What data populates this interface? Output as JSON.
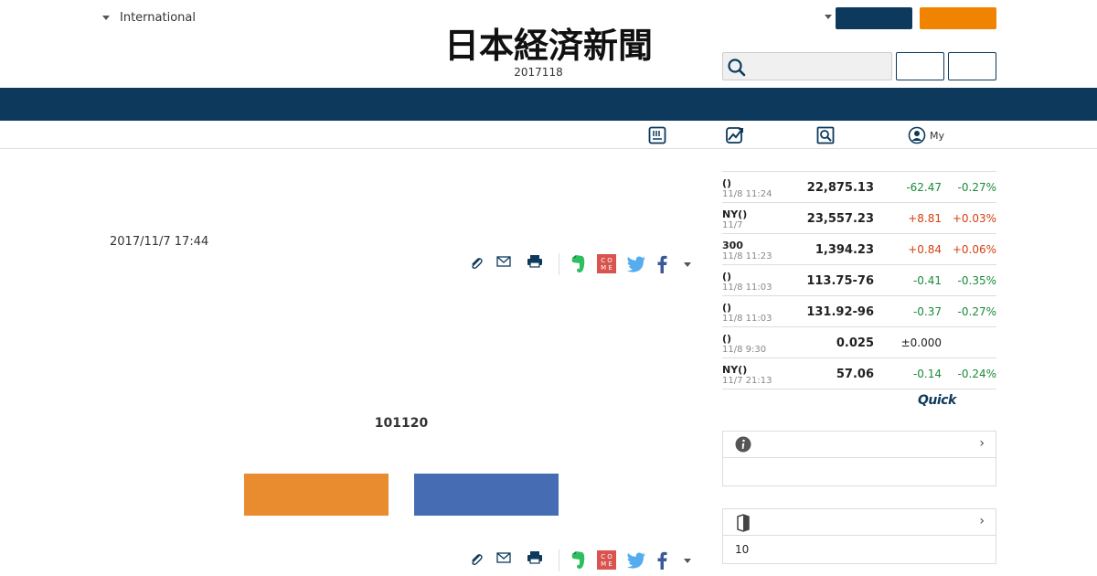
{
  "header": {
    "edition_label": "International",
    "logo_text": "日本経済新聞",
    "date": "2017118",
    "colors": {
      "navy": "#0d3a5c",
      "orange": "#f08300"
    }
  },
  "subnav": {
    "items": [
      {
        "icon": "newspaper-icon",
        "label": ""
      },
      {
        "icon": "chart-icon",
        "label": ""
      },
      {
        "icon": "search-icon",
        "label": ""
      },
      {
        "icon": "user-icon",
        "label": "My"
      }
    ]
  },
  "article": {
    "published": "2017/11/7 17:44",
    "heading": "101120",
    "share_icons": [
      "paperclip-icon",
      "mail-icon",
      "print-icon",
      "evernote-icon",
      "comment-icon",
      "twitter-icon",
      "facebook-icon",
      "more-caret-icon"
    ]
  },
  "market": {
    "rows": [
      {
        "name": "()",
        "time": "11/8 11:24",
        "value": "22,875.13",
        "change": "-62.47",
        "pct": "-0.27%",
        "dir": "down"
      },
      {
        "name": "NY()",
        "time": "11/7",
        "value": "23,557.23",
        "change": "+8.81",
        "pct": "+0.03%",
        "dir": "up"
      },
      {
        "name": "300",
        "time": "11/8 11:23",
        "value": "1,394.23",
        "change": "+0.84",
        "pct": "+0.06%",
        "dir": "up"
      },
      {
        "name": "()",
        "time": "11/8 11:03",
        "value": "113.75-76",
        "change": "-0.41",
        "pct": "-0.35%",
        "dir": "down"
      },
      {
        "name": "()",
        "time": "11/8 11:03",
        "value": "131.92-96",
        "change": "-0.37",
        "pct": "-0.27%",
        "dir": "down"
      },
      {
        "name": "()",
        "time": "11/8 9:30",
        "value": "0.025",
        "change": "±0.000",
        "pct": "",
        "dir": "flat"
      },
      {
        "name": "NY()",
        "time": "11/7 21:13",
        "value": "57.06",
        "change": "-0.14",
        "pct": "-0.24%",
        "dir": "down"
      }
    ],
    "source": "Quick",
    "colors": {
      "down": "#1a8a3a",
      "up": "#d4400f",
      "flat": "#222222"
    }
  },
  "side": {
    "info_box": {
      "icon": "info-icon",
      "body": ""
    },
    "guide_box": {
      "icon": "bookmark-icon",
      "body": "10"
    }
  }
}
